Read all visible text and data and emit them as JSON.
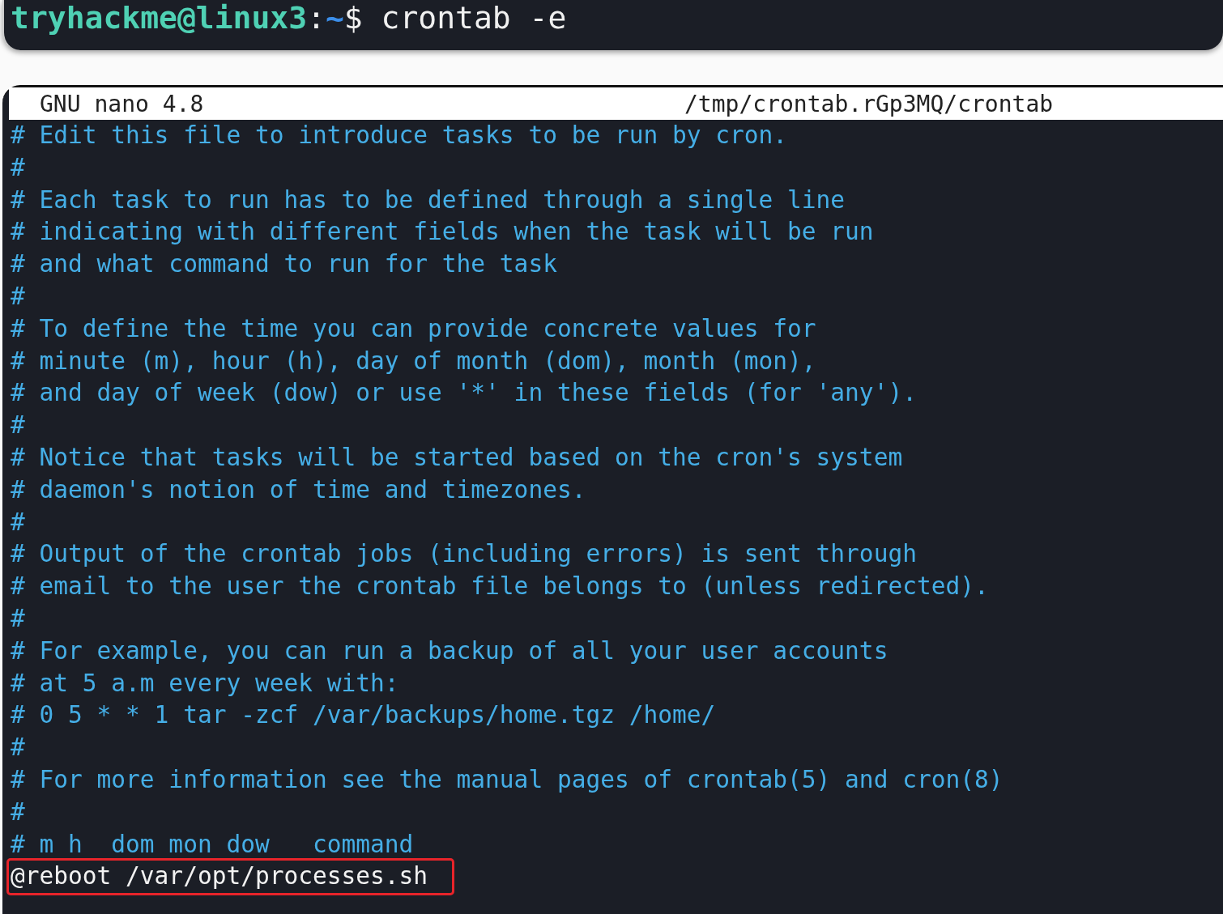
{
  "terminal": {
    "prompt": {
      "user_host": "tryhackme@linux3",
      "separator": ":",
      "path": "~",
      "symbol": "$",
      "command": "crontab -e"
    }
  },
  "editor": {
    "app_title": "GNU nano 4.8",
    "file_path": "/tmp/crontab.rGp3MQ/crontab",
    "lines": [
      {
        "kind": "comment",
        "text": "# Edit this file to introduce tasks to be run by cron."
      },
      {
        "kind": "comment",
        "text": "#"
      },
      {
        "kind": "comment",
        "text": "# Each task to run has to be defined through a single line"
      },
      {
        "kind": "comment",
        "text": "# indicating with different fields when the task will be run"
      },
      {
        "kind": "comment",
        "text": "# and what command to run for the task"
      },
      {
        "kind": "comment",
        "text": "#"
      },
      {
        "kind": "comment",
        "text": "# To define the time you can provide concrete values for"
      },
      {
        "kind": "comment",
        "text": "# minute (m), hour (h), day of month (dom), month (mon),"
      },
      {
        "kind": "comment",
        "text": "# and day of week (dow) or use '*' in these fields (for 'any')."
      },
      {
        "kind": "comment",
        "text": "#"
      },
      {
        "kind": "comment",
        "text": "# Notice that tasks will be started based on the cron's system"
      },
      {
        "kind": "comment",
        "text": "# daemon's notion of time and timezones."
      },
      {
        "kind": "comment",
        "text": "#"
      },
      {
        "kind": "comment",
        "text": "# Output of the crontab jobs (including errors) is sent through"
      },
      {
        "kind": "comment",
        "text": "# email to the user the crontab file belongs to (unless redirected)."
      },
      {
        "kind": "comment",
        "text": "#"
      },
      {
        "kind": "comment",
        "text": "# For example, you can run a backup of all your user accounts"
      },
      {
        "kind": "comment",
        "text": "# at 5 a.m every week with:"
      },
      {
        "kind": "comment",
        "text": "# 0 5 * * 1 tar -zcf /var/backups/home.tgz /home/"
      },
      {
        "kind": "comment",
        "text": "#"
      },
      {
        "kind": "comment",
        "text": "# For more information see the manual pages of crontab(5) and cron(8)"
      },
      {
        "kind": "comment",
        "text": "#"
      },
      {
        "kind": "comment",
        "text": "# m h  dom mon dow   command"
      },
      {
        "kind": "entry",
        "text": "@reboot /var/opt/processes.sh",
        "highlighted": true
      }
    ]
  }
}
